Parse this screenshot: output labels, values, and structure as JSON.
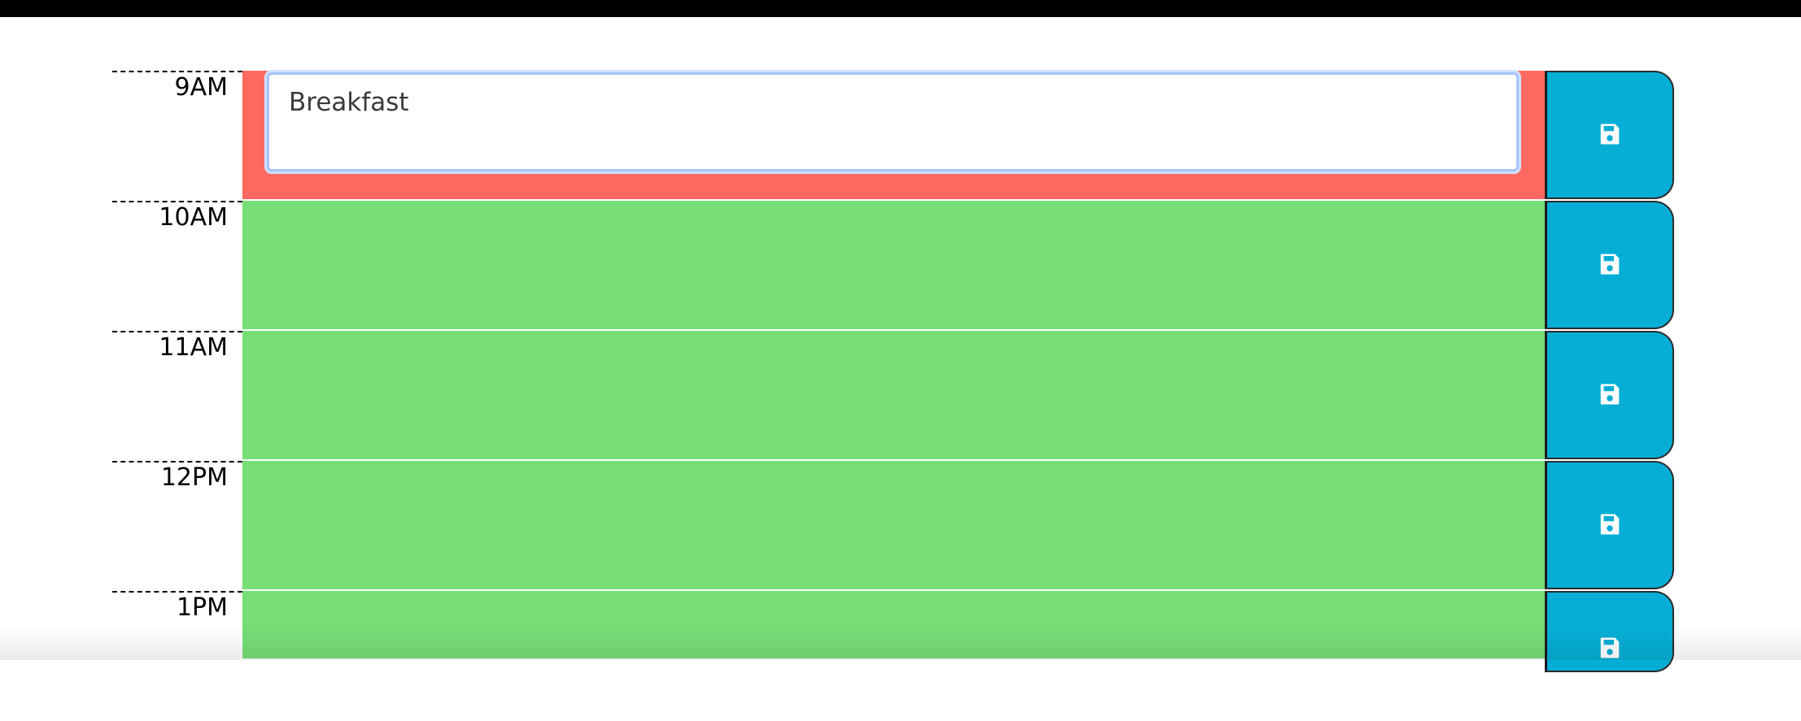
{
  "colors": {
    "past": "#ff6961",
    "future": "#77dd77",
    "save_button": "#06aed5"
  },
  "schedule": {
    "blocks": [
      {
        "hour": "9AM",
        "status": "past",
        "text": "Breakfast"
      },
      {
        "hour": "10AM",
        "status": "future",
        "text": ""
      },
      {
        "hour": "11AM",
        "status": "future",
        "text": ""
      },
      {
        "hour": "12PM",
        "status": "future",
        "text": ""
      },
      {
        "hour": "1PM",
        "status": "future",
        "text": ""
      }
    ],
    "save_icon": "save-icon"
  }
}
